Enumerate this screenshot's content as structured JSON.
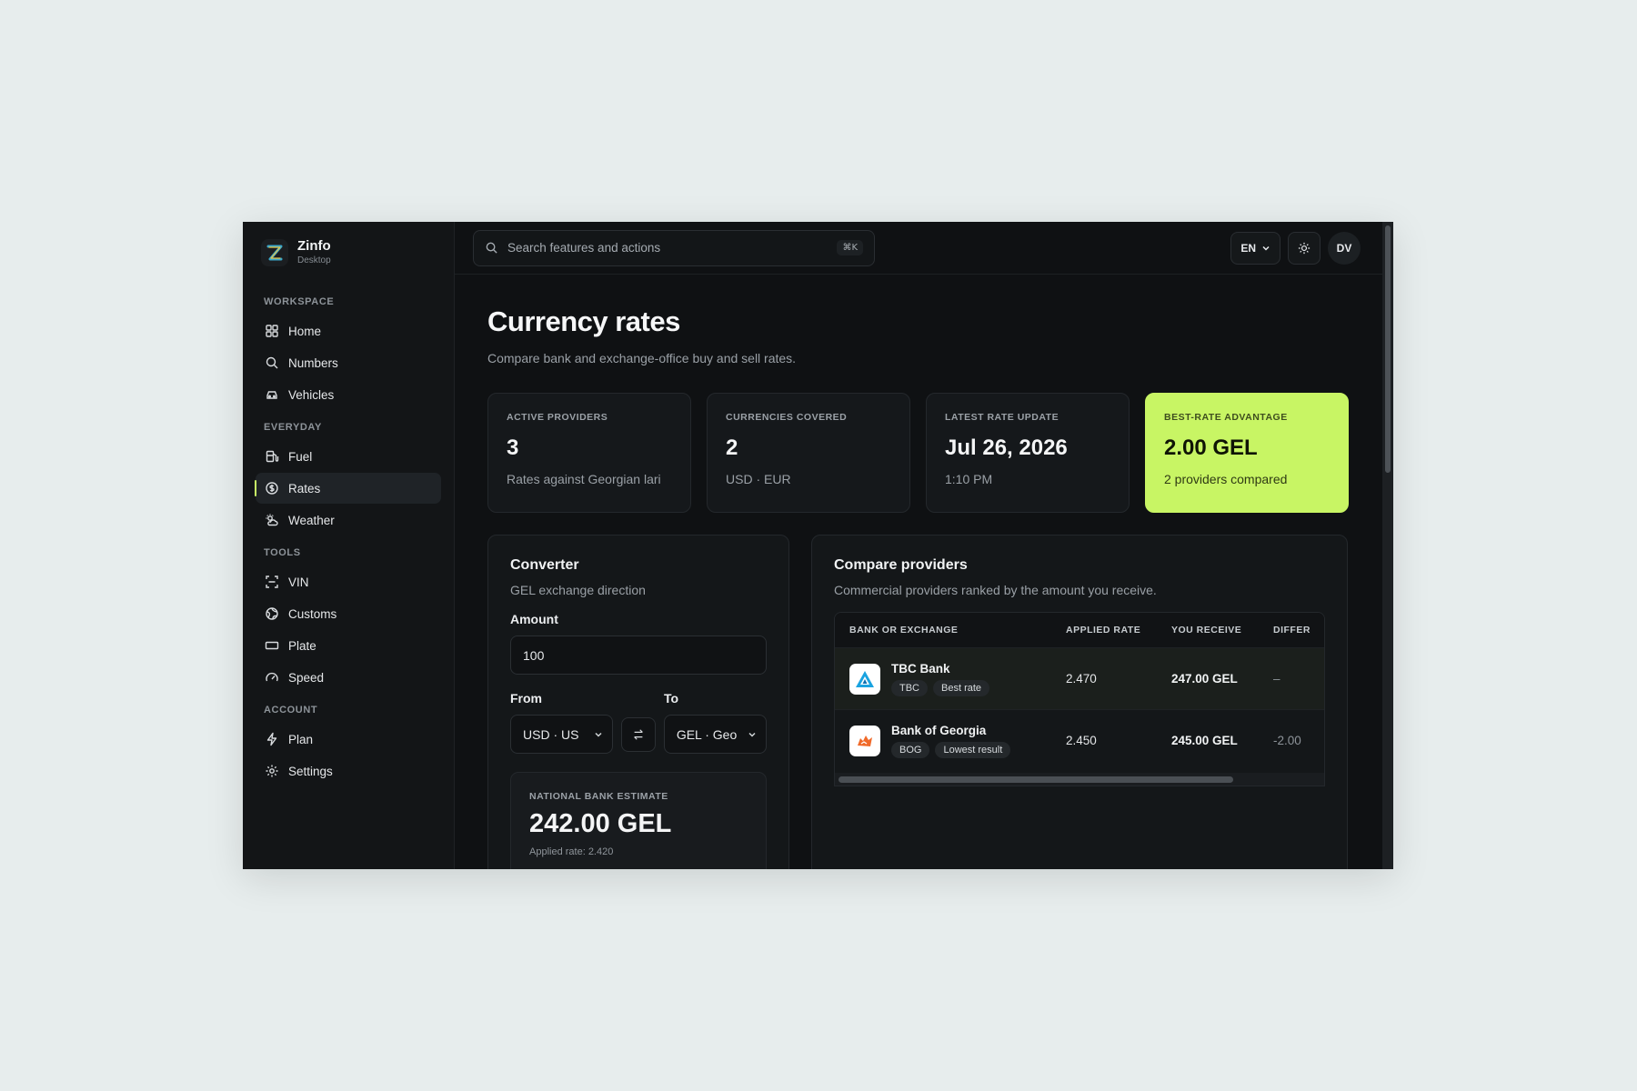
{
  "app": {
    "name": "Zinfo",
    "subtitle": "Desktop"
  },
  "sidebar": {
    "sections": [
      {
        "title": "WORKSPACE",
        "items": [
          {
            "label": "Home",
            "icon": "grid-icon"
          },
          {
            "label": "Numbers",
            "icon": "search-icon"
          },
          {
            "label": "Vehicles",
            "icon": "car-icon"
          }
        ]
      },
      {
        "title": "EVERYDAY",
        "items": [
          {
            "label": "Fuel",
            "icon": "fuel-icon"
          },
          {
            "label": "Rates",
            "icon": "coin-icon",
            "active": true
          },
          {
            "label": "Weather",
            "icon": "cloud-sun-icon"
          }
        ]
      },
      {
        "title": "TOOLS",
        "items": [
          {
            "label": "VIN",
            "icon": "scan-icon"
          },
          {
            "label": "Customs",
            "icon": "globe-icon"
          },
          {
            "label": "Plate",
            "icon": "plate-icon"
          },
          {
            "label": "Speed",
            "icon": "gauge-icon"
          }
        ]
      },
      {
        "title": "ACCOUNT",
        "items": [
          {
            "label": "Plan",
            "icon": "bolt-icon"
          },
          {
            "label": "Settings",
            "icon": "gear-icon"
          }
        ]
      }
    ]
  },
  "topbar": {
    "search_placeholder": "Search features and actions",
    "shortcut": "⌘K",
    "language": "EN",
    "avatar": "DV"
  },
  "page": {
    "title": "Currency rates",
    "subtitle": "Compare bank and exchange-office buy and sell rates."
  },
  "stats": [
    {
      "label": "ACTIVE PROVIDERS",
      "value": "3",
      "note": "Rates against Georgian lari"
    },
    {
      "label": "CURRENCIES COVERED",
      "value": "2",
      "note": "USD · EUR"
    },
    {
      "label": "LATEST RATE UPDATE",
      "value": "Jul 26, 2026",
      "note": "1:10 PM"
    },
    {
      "label": "BEST-RATE ADVANTAGE",
      "value": "2.00 GEL",
      "note": "2 providers compared"
    }
  ],
  "converter": {
    "title": "Converter",
    "subtitle": "GEL exchange direction",
    "amount_label": "Amount",
    "amount_value": "100",
    "from_label": "From",
    "to_label": "To",
    "from_value": "USD · US",
    "to_value": "GEL · Geo",
    "estimate_label": "NATIONAL BANK ESTIMATE",
    "estimate_value": "242.00 GEL",
    "estimate_note": "Applied rate: 2.420"
  },
  "compare": {
    "title": "Compare providers",
    "subtitle": "Commercial providers ranked by the amount you receive.",
    "columns": [
      "BANK OR EXCHANGE",
      "APPLIED RATE",
      "YOU RECEIVE",
      "DIFFER"
    ],
    "rows": [
      {
        "name": "TBC Bank",
        "code": "TBC",
        "badge": "Best rate",
        "rate": "2.470",
        "receive": "247.00 GEL",
        "diff": "–"
      },
      {
        "name": "Bank of Georgia",
        "code": "BOG",
        "badge": "Lowest result",
        "rate": "2.450",
        "receive": "245.00 GEL",
        "diff": "-2.00"
      }
    ]
  },
  "colors": {
    "accent": "#c8f564",
    "background": "#0f1113"
  }
}
